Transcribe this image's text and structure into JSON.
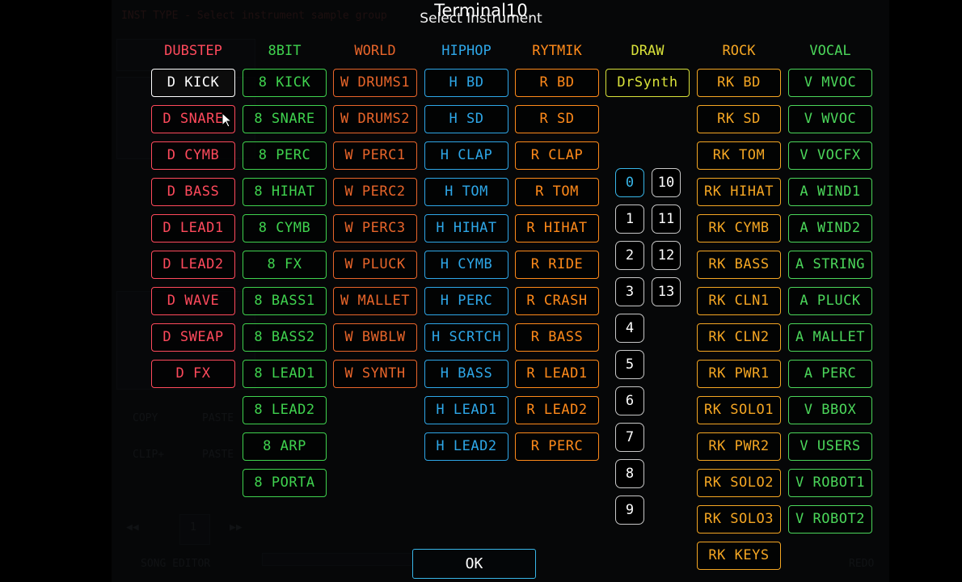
{
  "title": {
    "app": "Terminal10",
    "dialog": "Select Instrument"
  },
  "background": {
    "inst_type": "INST TYPE - Select instrument sample group",
    "copy": "COPY",
    "paste1": "PASTE",
    "clip": "CLIP+",
    "paste2": "PASTE",
    "song_editor": "SONG EDITOR",
    "redo": "REDO",
    "page": "1"
  },
  "colors": {
    "dubstep": "#ff4a5c",
    "bit8": "#3fd24e",
    "world": "#e8652a",
    "hiphop": "#2ea7e8",
    "rytmik": "#ff8a1a",
    "draw": "#d9e23a",
    "rock": "#f4a623",
    "vocal": "#4bd65a",
    "selected_item": "#ffffff",
    "selected_number": "#38b6e8"
  },
  "columns": [
    {
      "key": "dubstep",
      "header": "DUBSTEP",
      "items": [
        "D KICK",
        "D SNARE",
        "D CYMB",
        "D BASS",
        "D LEAD1",
        "D LEAD2",
        "D WAVE",
        "D SWEAP",
        "D FX"
      ]
    },
    {
      "key": "bit8",
      "header": "8BIT",
      "items": [
        "8 KICK",
        "8 SNARE",
        "8 PERC",
        "8 HIHAT",
        "8 CYMB",
        "8 FX",
        "8 BASS1",
        "8 BASS2",
        "8 LEAD1",
        "8 LEAD2",
        "8 ARP",
        "8 PORTA"
      ]
    },
    {
      "key": "world",
      "header": "WORLD",
      "items": [
        "W DRUMS1",
        "W DRUMS2",
        "W PERC1",
        "W PERC2",
        "W PERC3",
        "W PLUCK",
        "W MALLET",
        "W BWBLW",
        "W SYNTH"
      ]
    },
    {
      "key": "hiphop",
      "header": "HIPHOP",
      "items": [
        "H BD",
        "H SD",
        "H CLAP",
        "H TOM",
        "H HIHAT",
        "H CYMB",
        "H PERC",
        "H SCRTCH",
        "H BASS",
        "H LEAD1",
        "H LEAD2"
      ]
    },
    {
      "key": "rytmik",
      "header": "RYTMIK",
      "items": [
        "R BD",
        "R SD",
        "R CLAP",
        "R TOM",
        "R HIHAT",
        "R RIDE",
        "R CRASH",
        "R BASS",
        "R LEAD1",
        "R LEAD2",
        "R PERC"
      ]
    },
    {
      "key": "draw",
      "header": "DRAW",
      "items": [
        "DrSynth"
      ]
    },
    {
      "key": "rock",
      "header": "ROCK",
      "items": [
        "RK BD",
        "RK SD",
        "RK TOM",
        "RK HIHAT",
        "RK CYMB",
        "RK BASS",
        "RK CLN1",
        "RK CLN2",
        "RK PWR1",
        "RK SOLO1",
        "RK PWR2",
        "RK SOLO2",
        "RK SOLO3",
        "RK KEYS"
      ]
    },
    {
      "key": "vocal",
      "header": "VOCAL",
      "items": [
        "V MVOC",
        "V WVOC",
        "V VOCFX",
        "A WIND1",
        "A WIND2",
        "A STRING",
        "A PLUCK",
        "A MALLET",
        "A PERC",
        "V BBOX",
        "V USERS",
        "V ROBOT1",
        "V ROBOT2"
      ]
    }
  ],
  "selected_instrument": "D KICK",
  "numbers_left": [
    "0",
    "1",
    "2",
    "3",
    "4",
    "5",
    "6",
    "7",
    "8",
    "9"
  ],
  "numbers_right": [
    "10",
    "11",
    "12",
    "13"
  ],
  "selected_number": "0",
  "ok_label": "OK"
}
